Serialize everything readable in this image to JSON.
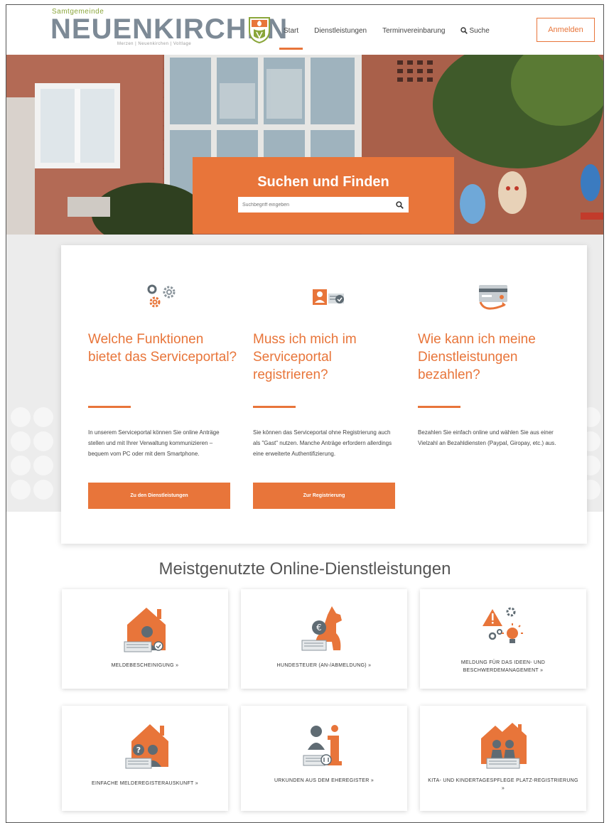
{
  "header": {
    "logo_small": "Samtgemeinde",
    "logo_big": "NEUENKIRCHEN",
    "logo_sub": "Merzen | Neuenkirchen | Voltlage",
    "nav": [
      {
        "label": "Start",
        "active": true
      },
      {
        "label": "Dienstleistungen",
        "active": false
      },
      {
        "label": "Terminvereinbarung",
        "active": false
      }
    ],
    "search_label": "Suche",
    "login_label": "Anmelden"
  },
  "hero": {
    "title": "Suchen und Finden",
    "search_placeholder": "Suchbegriff eingeben"
  },
  "info": [
    {
      "icon": "gears-icon",
      "question": "Welche Funktionen bietet das Serviceportal?",
      "text": "In unserem Serviceportal können Sie online Anträge stellen und mit Ihrer Verwaltung kommunizieren – bequem vom PC oder mit dem Smartphone.",
      "button": "Zu den Dienstleistungen"
    },
    {
      "icon": "id-card-icon",
      "question": "Muss ich mich im Serviceportal registrieren?",
      "text": "Sie können das Serviceportal ohne Registrierung auch als \"Gast\" nutzen. Manche Anträge erfordern allerdings eine erweiterte Authentifizierung.",
      "button": "Zur Registrierung"
    },
    {
      "icon": "payment-card-icon",
      "question": "Wie kann ich meine Dienstleistungen bezahlen?",
      "text": "Bezahlen Sie einfach online und wählen Sie aus einer Vielzahl an Bezahldiensten (Paypal, Giropay, etc.) aus.",
      "button": ""
    }
  ],
  "most_used": {
    "title": "Meistgenutzte Online-Dienstleistungen",
    "tiles": [
      {
        "label": "MELDEBESCHEINIGUNG »",
        "icon": "house-person-icon"
      },
      {
        "label": "HUNDESTEUER (AN-/ABMELDUNG) »",
        "icon": "dog-tax-icon"
      },
      {
        "label": "MELDUNG FÜR DAS IDEEN- UND BESCHWERDEMANAGEMENT »",
        "icon": "warning-idea-icon"
      },
      {
        "label": "EINFACHE MELDEREGISTERAUSKUNFT »",
        "icon": "house-question-icon"
      },
      {
        "label": "URKUNDEN AUS DEM EHEREGISTER »",
        "icon": "person-info-icon"
      },
      {
        "label": "KITA- UND KINDERTAGESPFLEGE PLATZ-REGISTRIERUNG »",
        "icon": "house-children-icon"
      }
    ]
  },
  "colors": {
    "accent": "#e8753a",
    "logo_grey": "#7d8a96",
    "logo_green": "#8aa63a",
    "icon_grey": "#5f6b73"
  }
}
